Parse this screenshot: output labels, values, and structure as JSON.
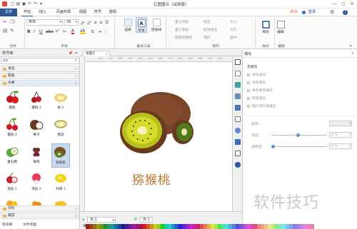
{
  "window": {
    "title": "亿图图示（试用版）"
  },
  "quick_access_icons": [
    "new-file-icon",
    "open-icon",
    "save-icon",
    "undo-icon",
    "redo-icon",
    "dropdown-icon"
  ],
  "menubar": {
    "items": [
      "文件",
      "开始",
      "插入",
      "页面布局",
      "视图",
      "符号",
      "帮助"
    ],
    "right": {
      "buy": "购买",
      "login": "登录"
    }
  },
  "ribbon": {
    "font_name": "宋体",
    "font_size": "36",
    "groups": [
      "文件",
      "字体",
      "基本工具",
      "排列",
      "样式",
      "编辑"
    ],
    "tools": {
      "select": "选择",
      "text": "文本",
      "connector": "连接线",
      "style": "样式",
      "edit": "编辑"
    },
    "arrange": [
      "置于顶层",
      "置于底层",
      "组合",
      "取消组合",
      "大小",
      "对齐",
      "居中",
      "分布",
      "旋转和翻转",
      "保护",
      "格式刷"
    ]
  },
  "library": {
    "header": "符号库",
    "categories_top": [
      "食品",
      "图表",
      "水果"
    ],
    "shapes": [
      {
        "name": "樱桃"
      },
      {
        "name": "樱桃 2"
      },
      {
        "name": "桃 1"
      },
      {
        "name": "樱桃 2"
      },
      {
        "name": "椰子"
      },
      {
        "name": "榴莲"
      },
      {
        "name": "番石榴"
      },
      {
        "name": "葡萄"
      },
      {
        "name": "猕猴桃"
      },
      {
        "name": "荔枝 1"
      },
      {
        "name": "荔枝 2"
      },
      {
        "name": "柠檬 1"
      },
      {
        "name": "柠檬 2"
      },
      {
        "name": "芒果"
      },
      {
        "name": "芒果"
      }
    ],
    "categories_bottom": [
      "饮料",
      "蔬菜"
    ],
    "bottom_tabs": [
      "符号库",
      "文件恢复"
    ]
  },
  "document": {
    "tab": "绘图1",
    "page_name": "页-1",
    "page_tab": "页-1",
    "fill_label": "填充"
  },
  "canvas": {
    "text": "猕猴桃"
  },
  "ruler": {
    "top_ticks": [
      "100",
      "110",
      "120",
      "130",
      "140",
      "150",
      "160",
      "170",
      "180",
      "190",
      "200",
      "210",
      "220",
      "230"
    ]
  },
  "fill_panel": {
    "title": "填充",
    "options": [
      "无填充",
      "单色填充",
      "渐变填充",
      "单色渐变填充",
      "图案填充",
      "图片或纹理填充"
    ],
    "color_label": "颜色：",
    "brightness_label": "亮度：",
    "brightness_value": "0 %",
    "transparency_label": "透明度：",
    "transparency_value": "0 %"
  },
  "watermark": "软件技巧",
  "colors": {
    "accent": "#2b5797",
    "text_brown": "#b5742f"
  }
}
